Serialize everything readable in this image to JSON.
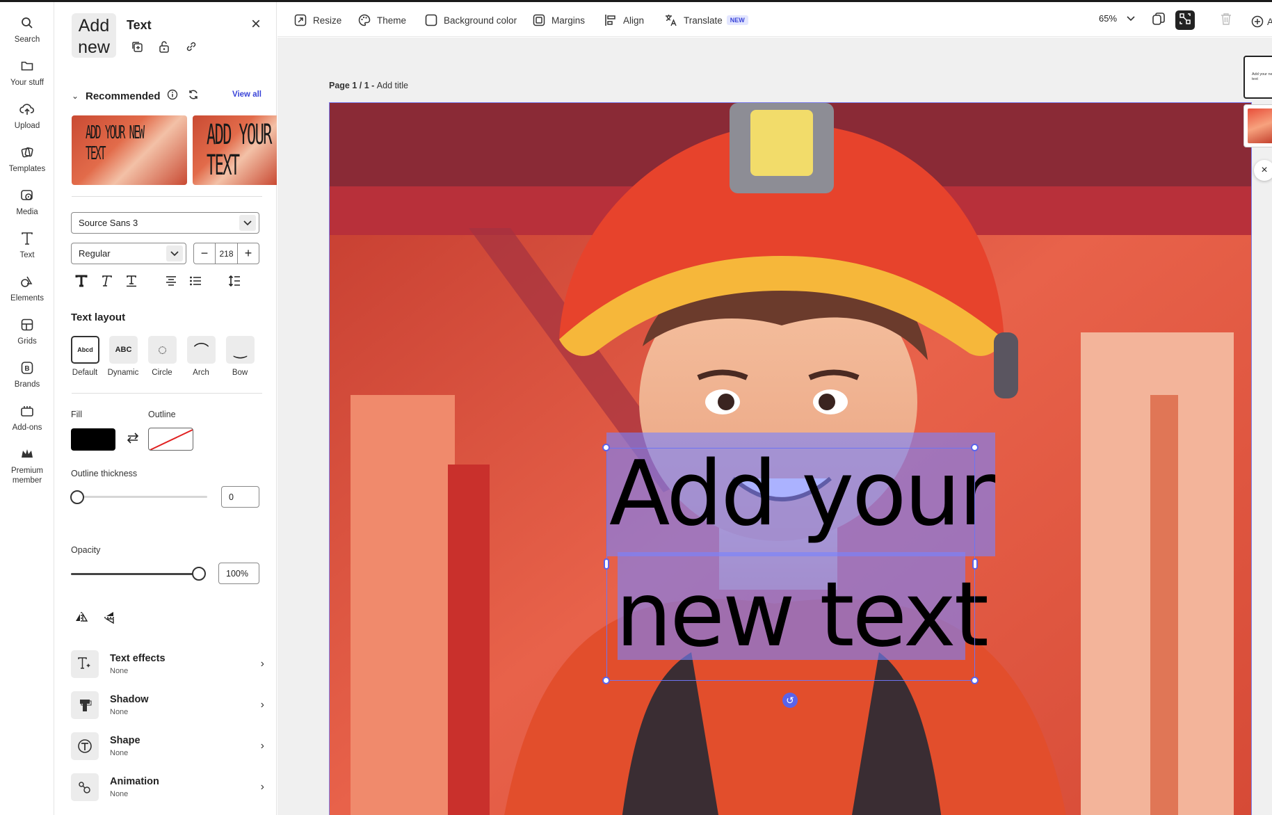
{
  "rail": {
    "items": [
      {
        "label": "Search",
        "icon": "search-icon"
      },
      {
        "label": "Your stuff",
        "icon": "folder-icon"
      },
      {
        "label": "Upload",
        "icon": "upload-cloud-icon"
      },
      {
        "label": "Templates",
        "icon": "templates-icon"
      },
      {
        "label": "Media",
        "icon": "media-icon"
      },
      {
        "label": "Text",
        "icon": "text-icon"
      },
      {
        "label": "Elements",
        "icon": "elements-icon"
      },
      {
        "label": "Grids",
        "icon": "grids-icon"
      },
      {
        "label": "Brands",
        "icon": "brands-icon"
      },
      {
        "label": "Add-ons",
        "icon": "add-ons-icon"
      },
      {
        "label": "Premium\nmember",
        "icon": "premium-crown-icon"
      }
    ]
  },
  "panel": {
    "preview_text": "Add new",
    "title": "Text",
    "recommended_label": "Recommended",
    "view_all": "View all",
    "thumb1_text": "ADD YOUR NEW TEXT",
    "thumb2_text": "ADD YOUR NEW TEXT",
    "font_family": "Source Sans 3",
    "font_style": "Regular",
    "font_size": "218",
    "text_layout_label": "Text layout",
    "layouts": [
      {
        "label": "Default",
        "glyph": "Abcd"
      },
      {
        "label": "Dynamic",
        "glyph": "ABC"
      },
      {
        "label": "Circle",
        "glyph": "◌"
      },
      {
        "label": "Arch",
        "glyph": "⌒"
      },
      {
        "label": "Bow",
        "glyph": "‿"
      }
    ],
    "fill_label": "Fill",
    "outline_label": "Outline",
    "outline_thickness_label": "Outline thickness",
    "outline_thickness_value": "0",
    "opacity_label": "Opacity",
    "opacity_value": "100%",
    "opacity_fraction": 1.0,
    "properties": [
      {
        "name": "Text effects",
        "value": "None"
      },
      {
        "name": "Shadow",
        "value": "None"
      },
      {
        "name": "Shape",
        "value": "None"
      },
      {
        "name": "Animation",
        "value": "None"
      }
    ]
  },
  "topbar": {
    "resize": "Resize",
    "theme": "Theme",
    "background_color": "Background color",
    "margins": "Margins",
    "align": "Align",
    "translate": "Translate",
    "new_badge": "NEW",
    "zoom": "65%",
    "add_truncated": "A"
  },
  "canvas": {
    "page_label": "Page 1 / 1 - ",
    "page_title": "Add title",
    "text_content": "Add your\nnew text",
    "page_thumb_text": "Add your new text"
  },
  "colors": {
    "accent": "#5a63ea",
    "link": "#3a44d8",
    "fill": "#000000",
    "selection_highlight": "#7882ff"
  }
}
